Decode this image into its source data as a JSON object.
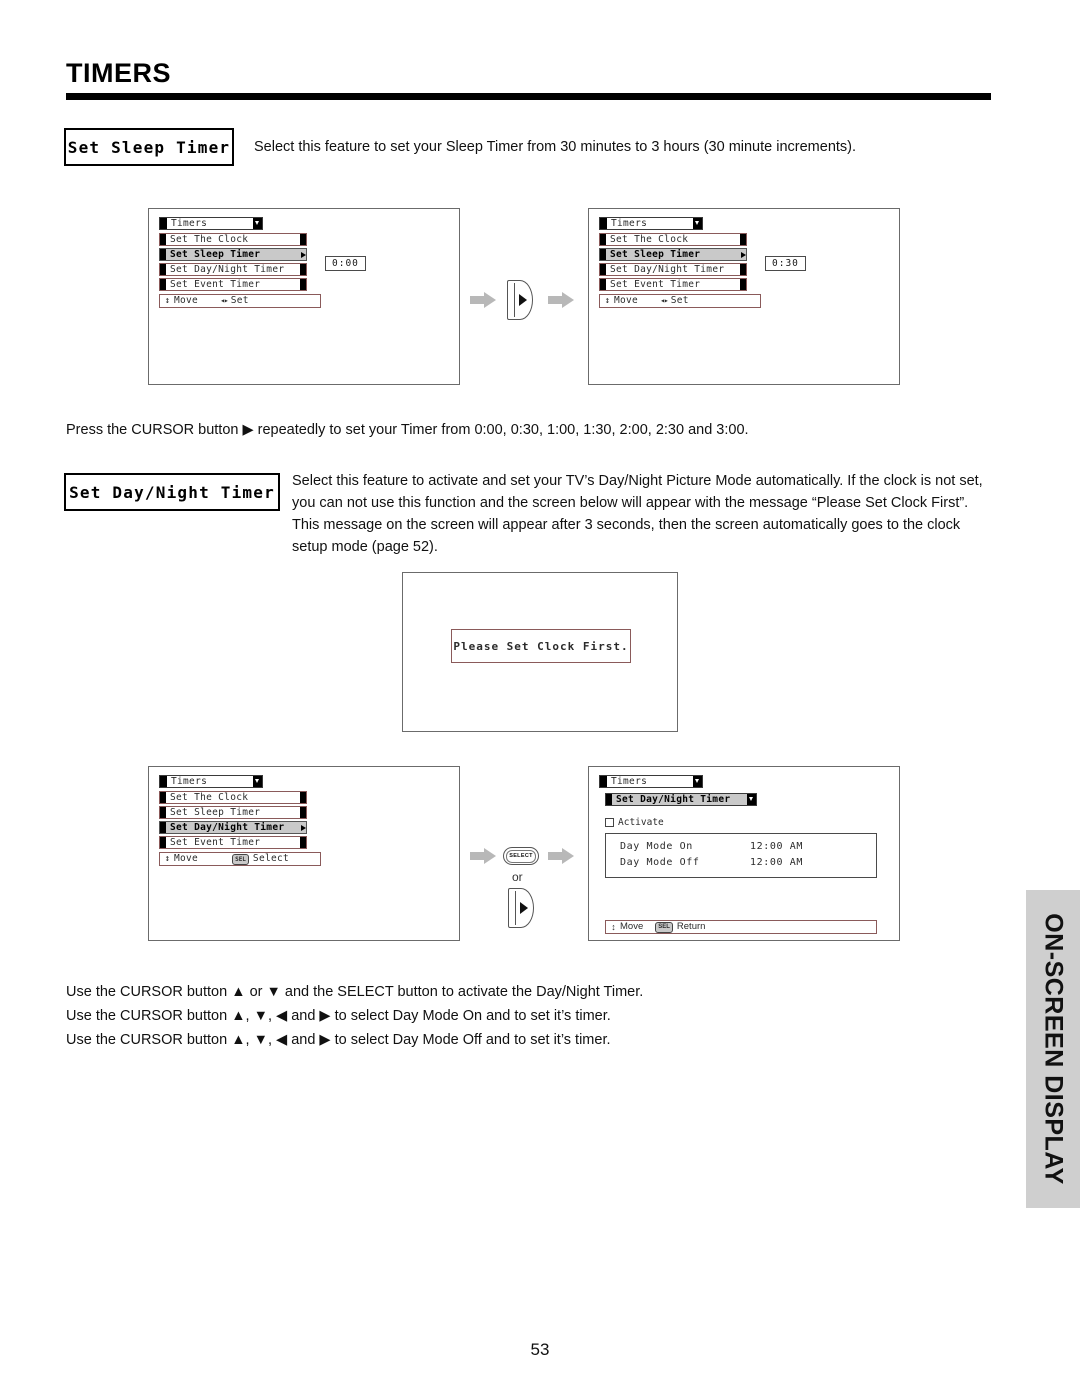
{
  "page": {
    "title": "TIMERS",
    "number": "53",
    "side_tab": "ON-SCREEN DISPLAY"
  },
  "sections": {
    "sleep": {
      "label": "Set Sleep Timer",
      "description": "Select this feature to set your Sleep Timer from 30 minutes to 3 hours (30 minute increments).",
      "cursor_note": "Press the CURSOR button ▶ repeatedly to set your Timer from 0:00, 0:30, 1:00, 1:30, 2:00, 2:30 and 3:00."
    },
    "daynight": {
      "label": "Set Day/Night Timer",
      "description": "Select this feature to activate and set your TV’s Day/Night Picture Mode automatically. If the clock is not set, you can not use this function and the screen below will appear with the message “Please Set Clock First”. This message on the screen will appear after 3 seconds, then the screen automatically goes to the clock setup mode (page 52).",
      "usage": [
        "Use the CURSOR button ▲ or ▼ and the SELECT button to activate the Day/Night Timer.",
        "Use the CURSOR button ▲, ▼, ◀ and ▶ to select Day Mode On and to set it’s timer.",
        "Use the CURSOR button ▲, ▼, ◀ and ▶ to select Day Mode Off and to set it’s timer."
      ]
    }
  },
  "osd": {
    "menu_header": "Timers",
    "items": [
      "Set The Clock",
      "Set Sleep Timer",
      "Set Day/Night Timer",
      "Set Event Timer"
    ],
    "footer_move": "Move",
    "footer_set": "Set",
    "footer_select": "Select",
    "footer_return": "Return",
    "select_key_label": "SELECT",
    "sel_key_label": "SEL",
    "or_label": "or"
  },
  "screens": {
    "sleep_before": {
      "value": "0:00"
    },
    "sleep_after": {
      "value": "0:30"
    },
    "clock_warning": {
      "message": "Please Set Clock First."
    },
    "daynight_menu": {
      "selected": "Set Day/Night Timer"
    },
    "daynight_detail": {
      "submenu_title": "Set Day/Night Timer",
      "activate_label": "Activate",
      "rows": [
        {
          "name": "Day Mode On",
          "value": "12:00 AM"
        },
        {
          "name": "Day Mode Off",
          "value": "12:00 AM"
        }
      ]
    }
  }
}
